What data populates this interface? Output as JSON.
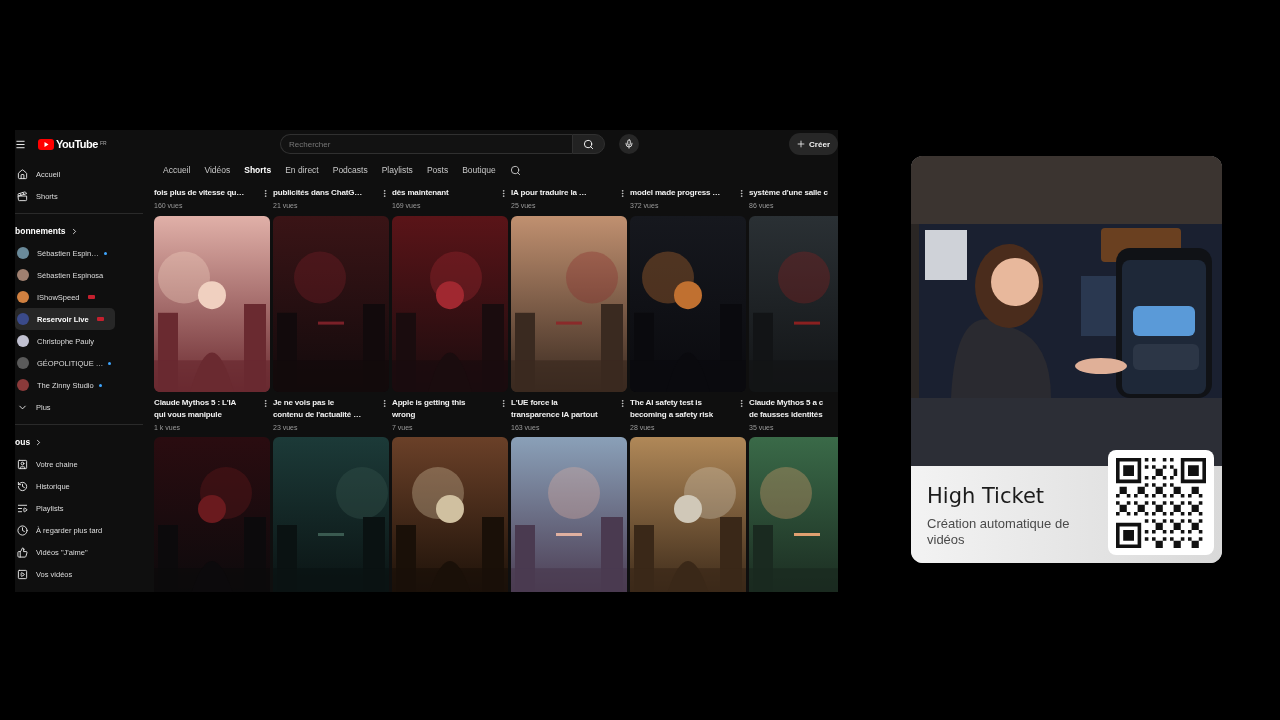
{
  "header": {
    "logo": "YouTube",
    "region": "FR",
    "search": {
      "placeholder": "Rechercher"
    },
    "create_button": "Créer"
  },
  "channel_tabs": [
    {
      "label": "Accueil",
      "selected": false
    },
    {
      "label": "Vidéos",
      "selected": false
    },
    {
      "label": "Shorts",
      "selected": true
    },
    {
      "label": "En direct",
      "selected": false
    },
    {
      "label": "Podcasts",
      "selected": false
    },
    {
      "label": "Playlists",
      "selected": false
    },
    {
      "label": "Posts",
      "selected": false
    },
    {
      "label": "Boutique",
      "selected": false
    }
  ],
  "sidebar": {
    "main": [
      {
        "label": "Accueil"
      },
      {
        "label": "Shorts"
      }
    ],
    "subscriptions": {
      "title": "bonnements",
      "channels": [
        {
          "name": "Sébastien Espin…",
          "kind": "new",
          "selected": false
        },
        {
          "name": "Sébastien Espinosa",
          "kind": "plain",
          "selected": false
        },
        {
          "name": "IShowSpeed",
          "kind": "live",
          "selected": false
        },
        {
          "name": "Reservoir Live",
          "kind": "live",
          "selected": true
        },
        {
          "name": "Christophe Pauly",
          "kind": "plain",
          "selected": false
        },
        {
          "name": "GÉOPOLITIQUE …",
          "kind": "new",
          "selected": false
        },
        {
          "name": "The Zinny Studio",
          "kind": "new",
          "selected": false
        }
      ],
      "more": "Plus"
    },
    "you": {
      "title": "ous",
      "items": [
        {
          "label": "Votre chaine"
        },
        {
          "label": "Historique"
        },
        {
          "label": "Playlists"
        },
        {
          "label": "À regarder plus tard"
        },
        {
          "label": "Vidéos \"J'aime\""
        },
        {
          "label": "Vos vidéos"
        }
      ]
    }
  },
  "shorts_top": [
    {
      "title": [
        "fois plus de vitesse qu…"
      ],
      "views": "160 vues"
    },
    {
      "title": [
        "publicités dans ChatG…"
      ],
      "views": "21 vues"
    },
    {
      "title": [
        "dès maintenant"
      ],
      "views": "169 vues"
    },
    {
      "title": [
        "IA pour traduire la …"
      ],
      "views": "25 vues"
    },
    {
      "title": [
        "model made progress …"
      ],
      "views": "372 vues"
    },
    {
      "title": [
        "système d'une salle c"
      ],
      "views": "86 vues"
    }
  ],
  "shorts": [
    {
      "kind": "picture",
      "title": [
        "Claude Mythos 5 : L'IA",
        "qui vous manipule"
      ],
      "views": "1 k vues"
    },
    {
      "kind": "picture",
      "title": [
        "Je ne vois pas le",
        "contenu de l'actualité …"
      ],
      "views": "23 vues"
    },
    {
      "kind": "picture",
      "title": [
        "Apple is getting this",
        "wrong"
      ],
      "views": "7 vues"
    },
    {
      "kind": "picture",
      "title": [
        "L'UE force la",
        "transparence IA partout"
      ],
      "views": "163 vues"
    },
    {
      "kind": "picture",
      "title": [
        "The AI safety test is",
        "becoming a safety risk"
      ],
      "views": "28 vues"
    },
    {
      "kind": "picture",
      "title": [
        "Claude Mythos 5 a c",
        "de fausses identités"
      ],
      "views": "35 vues"
    }
  ],
  "promo": {
    "kind": "picture",
    "title": "High Ticket",
    "subtitle": "Création automatique de vidéos"
  }
}
